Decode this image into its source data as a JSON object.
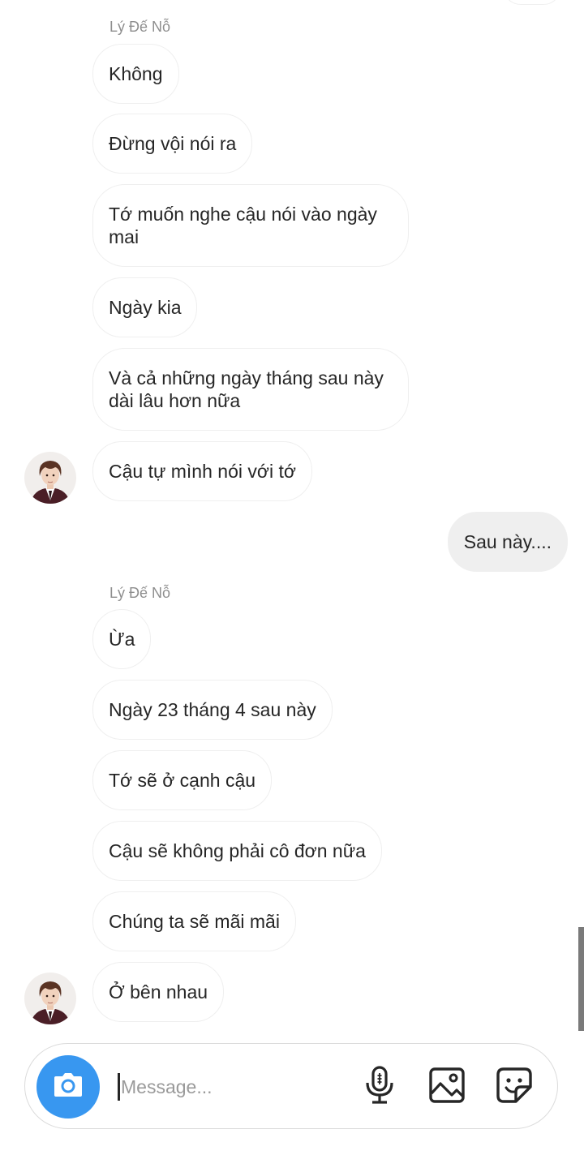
{
  "conversation": {
    "contact_name": "Lý Đế Nỗ",
    "messages_group1": [
      "Không",
      "Đừng vội nói ra",
      "Tớ muốn nghe cậu nói vào ngày mai",
      "Ngày kia",
      "Và cả những ngày tháng sau này dài lâu hơn nữa",
      "Cậu tự mình nói với tớ"
    ],
    "outgoing": [
      "Sau này...."
    ],
    "messages_group2": [
      "Ừa",
      "Ngày 23 tháng 4 sau này",
      "Tớ sẽ ở cạnh cậu",
      "Cậu sẽ không phải cô đơn nữa",
      "Chúng ta sẽ mãi mãi",
      "Ở bên nhau"
    ]
  },
  "composer": {
    "placeholder": "Message...",
    "value": "",
    "icons": {
      "camera": "camera-icon",
      "mic": "microphone-icon",
      "gallery": "image-icon",
      "sticker": "sticker-icon"
    }
  },
  "colors": {
    "accent": "#3897f0",
    "incoming_border": "#efefef",
    "outgoing_bg": "#efefef",
    "sender_name": "#8e8e8e",
    "text": "#262626"
  }
}
